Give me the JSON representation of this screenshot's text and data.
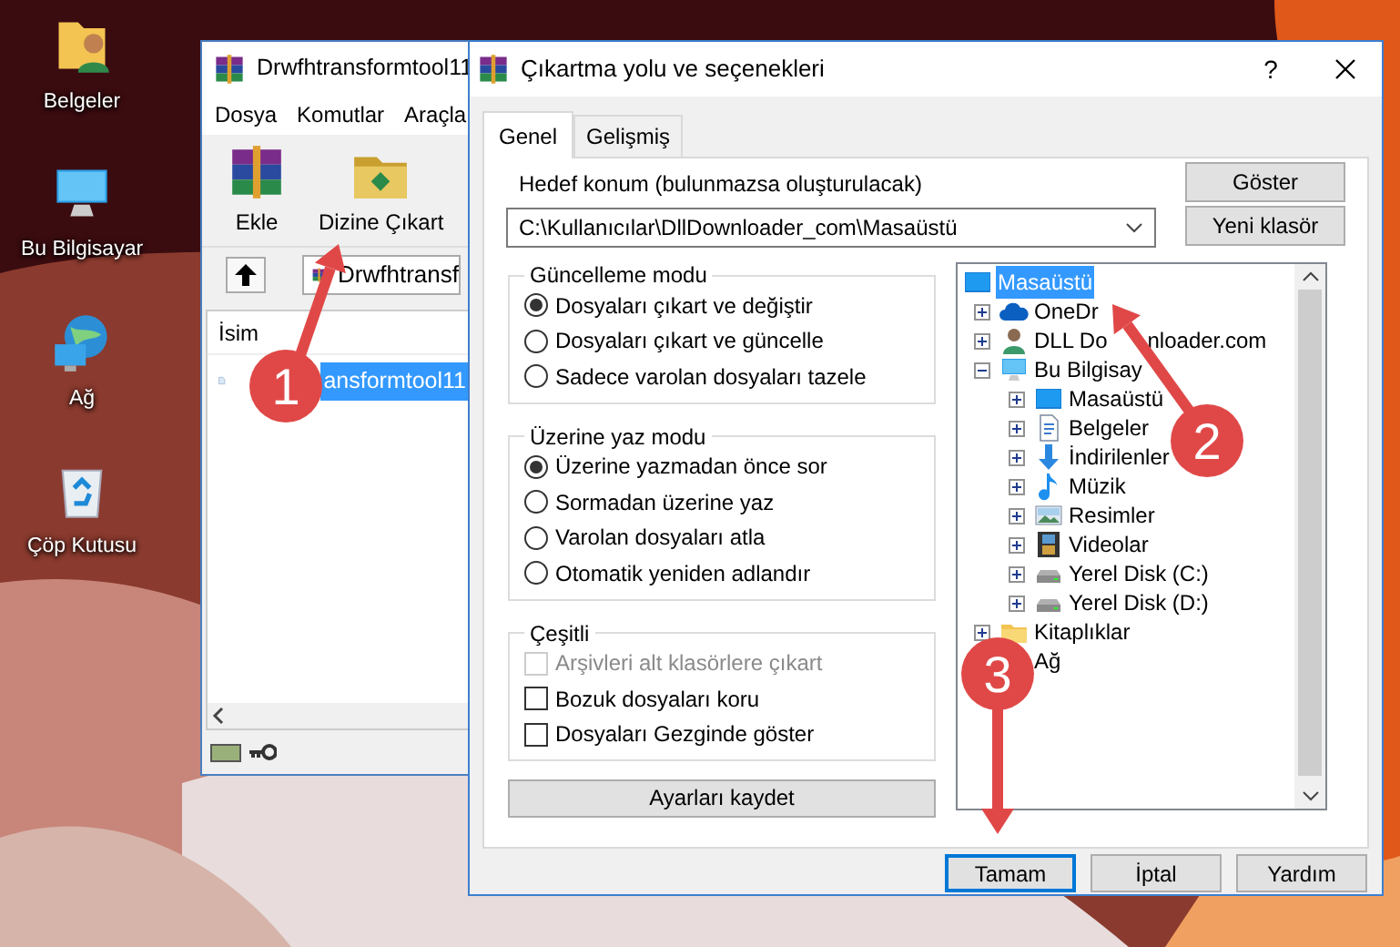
{
  "desktop_icons": [
    {
      "label": "Belgeler",
      "kind": "folder"
    },
    {
      "label": "Bu Bilgisayar",
      "kind": "computer"
    },
    {
      "label": "Ağ",
      "kind": "network"
    },
    {
      "label": "Çöp Kutusu",
      "kind": "recycle"
    }
  ],
  "archiver_window": {
    "title": "Drwfhtransformtool11",
    "menu": [
      "Dosya",
      "Komutlar",
      "Araçla"
    ],
    "toolbar": [
      {
        "label": "Ekle",
        "kind": "add"
      },
      {
        "label": "Dizine Çıkart",
        "kind": "extract"
      }
    ],
    "path": "Drwfhtransf",
    "column": "İsim",
    "files": [
      {
        "name": "ansformtool11",
        "selected": true
      }
    ]
  },
  "dialog": {
    "title": "Çıkartma yolu ve seçenekleri",
    "help": "?",
    "tabs": [
      {
        "label": "Genel",
        "selected": true
      },
      {
        "label": "Gelişmiş",
        "selected": false
      }
    ],
    "destination_label": "Hedef konum (bulunmazsa oluşturulacak)",
    "destination": "C:\\Kullanıcılar\\DllDownloader_com\\Masaüstü",
    "side_buttons": [
      "Göster",
      "Yeni klasör"
    ],
    "groups": [
      {
        "title": "Güncelleme modu",
        "options": [
          {
            "kind": "radio",
            "label": "Dosyaları çıkart ve değiştir",
            "selected": true
          },
          {
            "kind": "radio",
            "label": "Dosyaları çıkart ve güncelle",
            "selected": false
          },
          {
            "kind": "radio",
            "label": "Sadece varolan dosyaları tazele",
            "selected": false
          }
        ]
      },
      {
        "title": "Üzerine yaz modu",
        "options": [
          {
            "kind": "radio",
            "label": "Üzerine yazmadan önce sor",
            "selected": true
          },
          {
            "kind": "radio",
            "label": "Sormadan üzerine yaz",
            "selected": false
          },
          {
            "kind": "radio",
            "label": "Varolan dosyaları atla",
            "selected": false
          },
          {
            "kind": "radio",
            "label": "Otomatik yeniden adlandır",
            "selected": false
          }
        ]
      },
      {
        "title": "Çeşitli",
        "options": [
          {
            "kind": "checkbox",
            "label": "Arşivleri alt klasörlere çıkart",
            "checked": false,
            "disabled": true
          },
          {
            "kind": "checkbox",
            "label": "Bozuk dosyaları koru",
            "checked": false,
            "disabled": false
          },
          {
            "kind": "checkbox",
            "label": "Dosyaları Gezginde göster",
            "checked": false,
            "disabled": false
          }
        ]
      }
    ],
    "save_button": "Ayarları kaydet",
    "tree": [
      {
        "label": "Masaüstü",
        "kind": "desktop",
        "selected": true,
        "children": [
          {
            "label": "OneDr",
            "kind": "cloud",
            "expanded": false,
            "selected": false
          },
          {
            "label": "DLL Do",
            "label_tail": "nloader.com",
            "kind": "user",
            "expanded": false,
            "selected": false
          },
          {
            "label": "Bu Bilgisay",
            "kind": "computer",
            "expanded": true,
            "selected": false,
            "children": [
              {
                "label": "Masaüstü",
                "kind": "desktop",
                "expanded": false,
                "selected": false
              },
              {
                "label": "Belgeler",
                "kind": "documents",
                "expanded": false,
                "selected": false
              },
              {
                "label": "İndirilenler",
                "kind": "download",
                "expanded": false,
                "selected": false
              },
              {
                "label": "Müzik",
                "kind": "music",
                "expanded": false,
                "selected": false
              },
              {
                "label": "Resimler",
                "kind": "pictures",
                "expanded": false,
                "selected": false
              },
              {
                "label": "Videolar",
                "kind": "video",
                "expanded": false,
                "selected": false
              },
              {
                "label": "Yerel Disk (C:)",
                "kind": "drive",
                "expanded": false,
                "selected": false
              },
              {
                "label": "Yerel Disk (D:)",
                "kind": "drive",
                "expanded": false,
                "selected": false
              }
            ]
          },
          {
            "label": "Kitaplıklar",
            "kind": "folder",
            "expanded": false,
            "selected": false
          },
          {
            "label": "Ağ",
            "selected": false
          }
        ]
      }
    ],
    "buttons": [
      {
        "label": "Tamam",
        "default": true
      },
      {
        "label": "İptal",
        "default": false
      },
      {
        "label": "Yardım",
        "default": false
      }
    ]
  },
  "annotations": [
    {
      "number": "1"
    },
    {
      "number": "2"
    },
    {
      "number": "3"
    }
  ]
}
